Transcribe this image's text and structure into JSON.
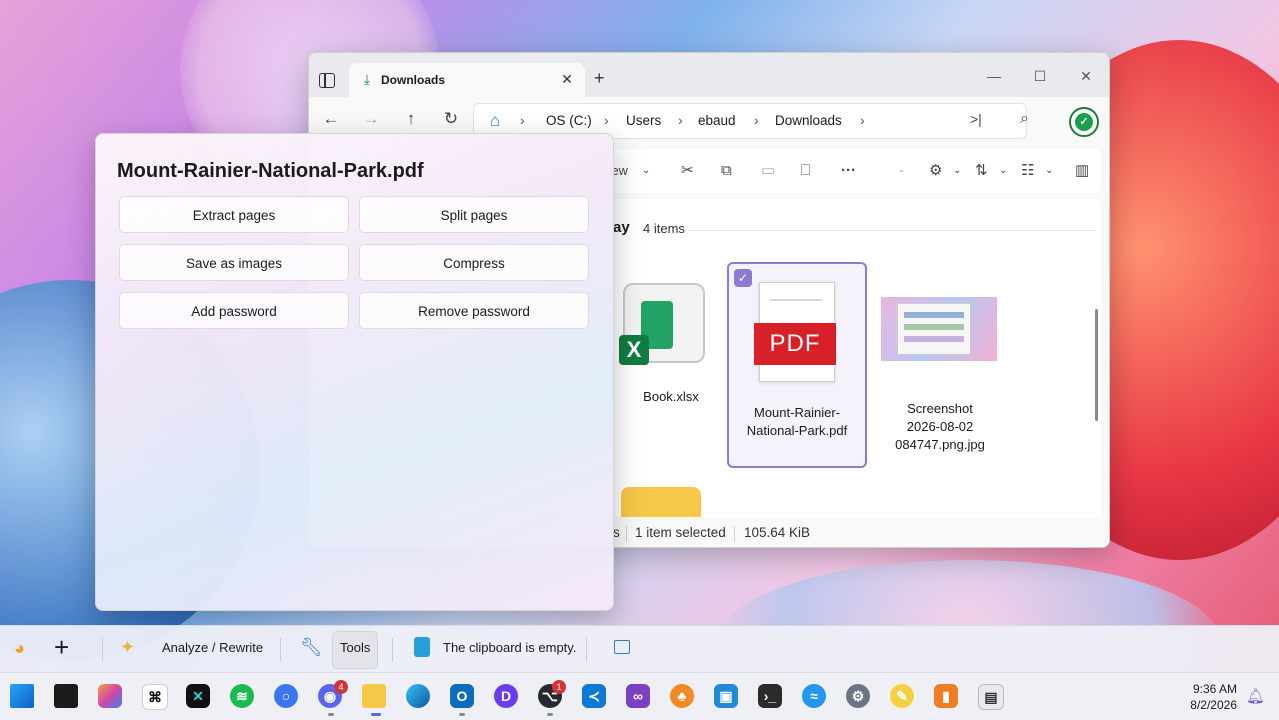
{
  "explorer": {
    "tab_title": "Downloads",
    "breadcrumb": [
      "OS (C:)",
      "Users",
      "ebaud",
      "Downloads"
    ],
    "toolbar": {
      "view_label": "iew"
    },
    "group": {
      "title": "ay",
      "count": "4 items"
    },
    "files": [
      {
        "name": "Book.xlsx",
        "type": "excel"
      },
      {
        "name": "Mount-Rainier-National-Park.pdf",
        "label_line1": "Mount-Rainier-",
        "label_line2": "National-Park.pdf",
        "type": "pdf",
        "selected": true,
        "badge": "PDF"
      },
      {
        "name": "Screenshot 2026-08-02 084747.png.jpg",
        "label_line1": "Screenshot",
        "label_line2": "2026-08-02",
        "label_line3": "084747.png.jpg",
        "type": "image"
      }
    ],
    "status": {
      "items_fragment": "s",
      "selected": "1 item selected",
      "size": "105.64 KiB"
    }
  },
  "flyout": {
    "file_name": "Mount-Rainier-National-Park.pdf",
    "buttons": [
      "Extract pages",
      "Split pages",
      "Save as images",
      "Compress",
      "Add password",
      "Remove password"
    ]
  },
  "assistant_bar": {
    "analyze_label": "Analyze / Rewrite",
    "tools_label": "Tools",
    "clipboard_status": "The clipboard is empty."
  },
  "taskbar": {
    "time": "9:36 AM",
    "date": "8/2/2026",
    "discord_badge": "4",
    "github_badge": "1",
    "icons": [
      "start-icon",
      "task-view-icon",
      "copilot-icon",
      "chatgpt-icon",
      "cursor-icon",
      "spotify-icon",
      "signal-icon",
      "discord-icon",
      "file-explorer-icon",
      "edge-icon",
      "outlook-icon",
      "perplexity-icon",
      "github-icon",
      "vscode-icon",
      "visual-studio-icon",
      "fl-studio-icon",
      "remote-desktop-icon",
      "terminal-icon",
      "docker-icon",
      "settings-icon",
      "paint-icon",
      "office-icon",
      "powertoys-icon"
    ]
  },
  "colors": {
    "selection": "#8d7bd0",
    "pdf_red": "#d72027",
    "excel_green": "#21a366",
    "accent_green": "#19a04a"
  }
}
